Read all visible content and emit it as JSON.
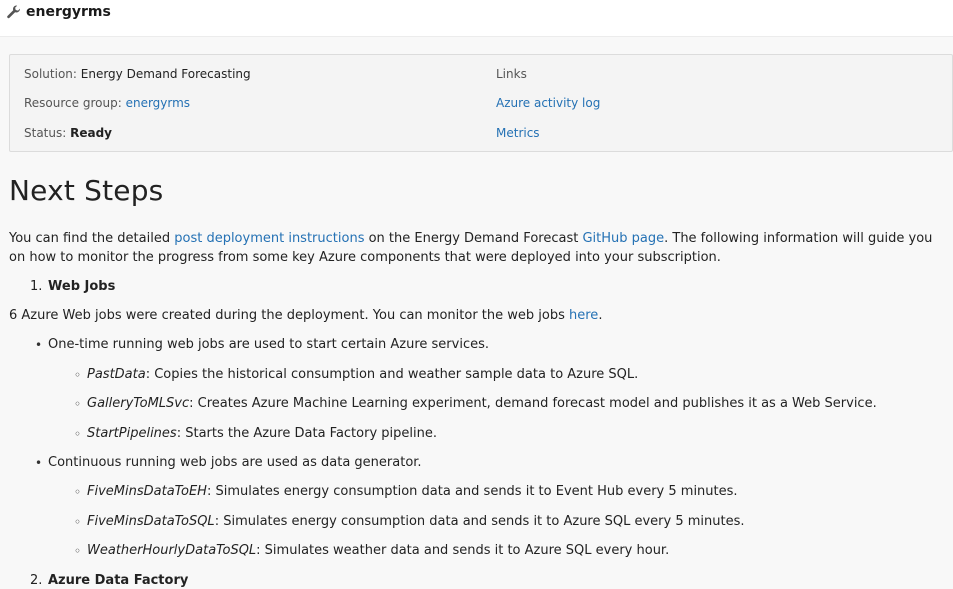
{
  "header": {
    "icon": "wrench-icon",
    "title": "energyrms"
  },
  "info": {
    "solution_label": "Solution:",
    "solution_value": "Energy Demand Forecasting",
    "resource_group_label": "Resource group:",
    "resource_group_value": "energyrms",
    "status_label": "Status:",
    "status_value": "Ready",
    "links_label": "Links",
    "link_activity_log": "Azure activity log",
    "link_metrics": "Metrics"
  },
  "content": {
    "heading": "Next Steps",
    "intro": {
      "t1": "You can find the detailed ",
      "link1": "post deployment instructions",
      "t2": " on the Energy Demand Forecast ",
      "link2": "GitHub page",
      "t3": ". The following information will guide you on how to monitor the progress from some key Azure components that were deployed into your subscription."
    },
    "step1": {
      "number": "1.",
      "title": "Web Jobs"
    },
    "webjobs_text": {
      "t1": "6 Azure Web jobs were created during the deployment. You can monitor the web jobs ",
      "link": "here",
      "t2": "."
    },
    "onetime": {
      "text": "One-time running web jobs are used to start certain Azure services.",
      "items": [
        {
          "name": "PastData",
          "desc": ": Copies the historical consumption and weather sample data to Azure SQL."
        },
        {
          "name": "GalleryToMLSvc",
          "desc": ": Creates Azure Machine Learning experiment, demand forecast model and publishes it as a Web Service."
        },
        {
          "name": "StartPipelines",
          "desc": ": Starts the Azure Data Factory pipeline."
        }
      ]
    },
    "continuous": {
      "text": "Continuous running web jobs are used as data generator.",
      "items": [
        {
          "name": "FiveMinsDataToEH",
          "desc": ": Simulates energy consumption data and sends it to Event Hub every 5 minutes."
        },
        {
          "name": "FiveMinsDataToSQL",
          "desc": ": Simulates energy consumption data and sends it to Azure SQL every 5 minutes."
        },
        {
          "name": "WeatherHourlyDataToSQL",
          "desc": ": Simulates weather data and sends it to Azure SQL every hour."
        }
      ]
    },
    "step2": {
      "number": "2.",
      "title": "Azure Data Factory"
    }
  }
}
